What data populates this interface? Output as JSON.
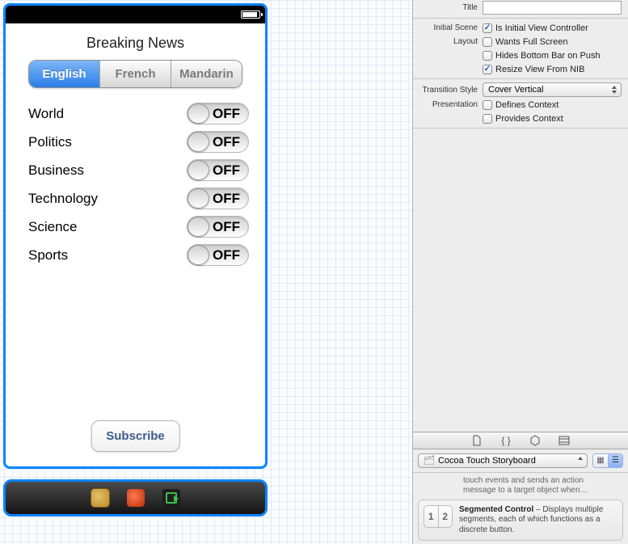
{
  "app": {
    "title": "Breaking News",
    "segments": [
      "English",
      "French",
      "Mandarin"
    ],
    "switches": [
      {
        "label": "World",
        "state": "OFF"
      },
      {
        "label": "Politics",
        "state": "OFF"
      },
      {
        "label": "Business",
        "state": "OFF"
      },
      {
        "label": "Technology",
        "state": "OFF"
      },
      {
        "label": "Science",
        "state": "OFF"
      },
      {
        "label": "Sports",
        "state": "OFF"
      }
    ],
    "subscribe": "Subscribe"
  },
  "inspector": {
    "title_label": "Title",
    "title_value": "",
    "initial_scene_label": "Initial Scene",
    "is_initial": "Is Initial View Controller",
    "layout_label": "Layout",
    "wants_full": "Wants Full Screen",
    "hides_bottom": "Hides Bottom Bar on Push",
    "resize_nib": "Resize View From NIB",
    "transition_label": "Transition Style",
    "transition_value": "Cover Vertical",
    "presentation_label": "Presentation",
    "defines_context": "Defines Context",
    "provides_context": "Provides Context"
  },
  "library": {
    "filter": "Cocoa Touch Storyboard",
    "clip_top": "touch events and sends an action message to a target object when…",
    "item": {
      "name": "Segmented Control",
      "desc": " – Displays multiple segments, each of which functions as a discrete button.",
      "thumb1": "1",
      "thumb2": "2"
    }
  }
}
